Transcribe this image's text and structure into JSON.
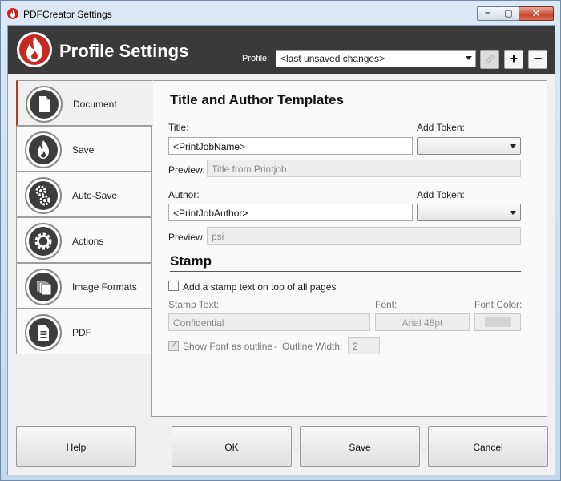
{
  "window": {
    "title": "PDFCreator Settings"
  },
  "header": {
    "title": "Profile Settings",
    "profile_label": "Profile:",
    "profile_value": "<last unsaved changes>",
    "add_label": "+",
    "remove_label": "−"
  },
  "sidebar": {
    "items": [
      {
        "label": "Document",
        "icon": "document-icon"
      },
      {
        "label": "Save",
        "icon": "flame-icon"
      },
      {
        "label": "Auto-Save",
        "icon": "gears-icon"
      },
      {
        "label": "Actions",
        "icon": "gear-icon"
      },
      {
        "label": "Image Formats",
        "icon": "images-icon"
      },
      {
        "label": "PDF",
        "icon": "pdf-icon"
      }
    ]
  },
  "document": {
    "templates_heading": "Title and Author Templates",
    "title_label": "Title:",
    "title_value": "<PrintJobName>",
    "add_token_label": "Add Token:",
    "preview_label": "Preview:",
    "title_preview": "Title from Printjob",
    "author_label": "Author:",
    "author_value": "<PrintJobAuthor>",
    "author_preview": "psi",
    "stamp_heading": "Stamp",
    "stamp_checkbox_label": "Add a stamp text on top of all pages",
    "stamp_text_label": "Stamp Text:",
    "stamp_text_value": "Confidential",
    "font_label": "Font:",
    "font_value": "Arial 48pt",
    "font_color_label": "Font Color:",
    "outline_checkbox_label": "Show Font as outline",
    "outline_sep": "-",
    "outline_width_label": "Outline Width:",
    "outline_width_value": "2"
  },
  "footer": {
    "help_label": "Help",
    "ok_label": "OK",
    "save_label": "Save",
    "cancel_label": "Cancel"
  },
  "colors": {
    "accent": "#b03a2e",
    "header_bg": "#3a3a3a",
    "logo_red": "#c8281e"
  }
}
